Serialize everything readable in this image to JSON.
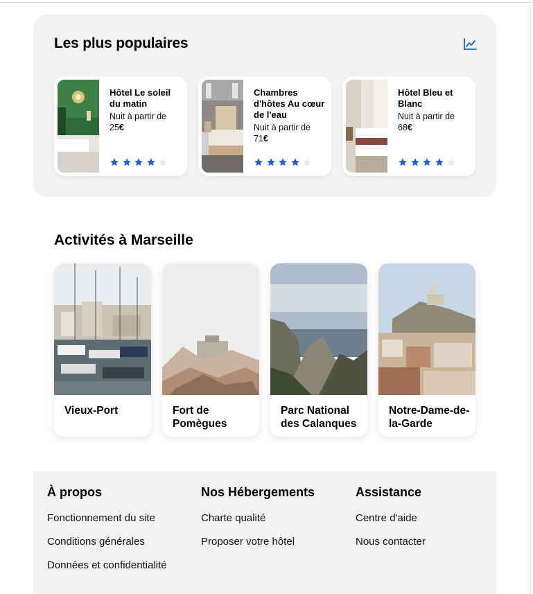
{
  "popular": {
    "title": "Les plus populaires",
    "chart_icon": "trend-chart-icon",
    "accent_color": "#1f5fd6",
    "hotels": [
      {
        "name": "Hôtel Le soleil du matin",
        "price_prefix": "Nuit à partir de ",
        "price_value": "25",
        "currency": "€",
        "rating": 4,
        "max_rating": 5
      },
      {
        "name": "Chambres d'hôtes Au cœur de l'eau",
        "price_prefix": "Nuit à partir de ",
        "price_value": "71",
        "currency": "€",
        "rating": 4,
        "max_rating": 5
      },
      {
        "name": "Hôtel Bleu et Blanc",
        "price_prefix": "Nuit à partir de ",
        "price_value": "68",
        "currency": "€",
        "rating": 4,
        "max_rating": 5
      }
    ]
  },
  "activities": {
    "title": "Activités à Marseille",
    "items": [
      {
        "name": "Vieux-Port"
      },
      {
        "name": "Fort de Pomègues"
      },
      {
        "name": "Parc National des Calanques"
      },
      {
        "name": "Notre-Dame-de-la-Garde"
      }
    ]
  },
  "footer": {
    "about": {
      "title": "À propos",
      "links": [
        "Fonctionnement du site",
        "Conditions générales",
        "Données et confidentialité"
      ]
    },
    "accommodations": {
      "title": "Nos Hébergements",
      "links": [
        "Charte qualité",
        "Proposer votre hôtel"
      ]
    },
    "support": {
      "title": "Assistance",
      "links": [
        "Centre d'aide",
        "Nous contacter"
      ]
    }
  }
}
